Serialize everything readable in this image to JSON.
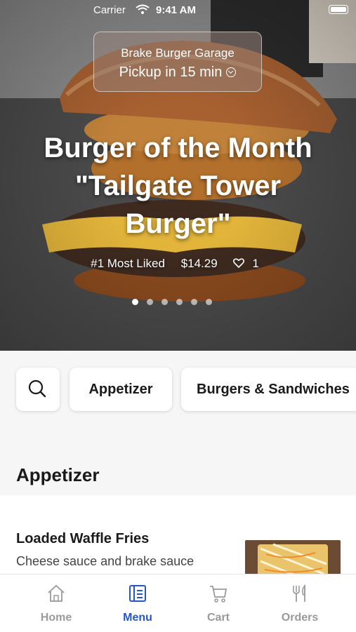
{
  "status_bar": {
    "carrier": "Carrier",
    "time": "9:41 AM"
  },
  "store": {
    "name": "Brake Burger Garage",
    "pickup": "Pickup in 15 min"
  },
  "promo": {
    "headline_line1": "Burger of the Month",
    "headline_line2": "\"Tailgate Tower",
    "headline_line3": "Burger\"",
    "badge": "#1 Most Liked",
    "price": "$14.29",
    "likes": "1",
    "carousel_pages": 6,
    "carousel_active": 1
  },
  "categories": {
    "search_icon": "search-icon",
    "items": [
      "Appetizer",
      "Burgers & Sandwiches"
    ]
  },
  "section": {
    "title": "Appetizer"
  },
  "menu_item": {
    "title": "Loaded Waffle Fries",
    "description": "Cheese sauce and brake sauce"
  },
  "tabs": [
    {
      "label": "Home",
      "icon": "home-icon",
      "active": false
    },
    {
      "label": "Menu",
      "icon": "menu-icon",
      "active": true
    },
    {
      "label": "Cart",
      "icon": "cart-icon",
      "active": false
    },
    {
      "label": "Orders",
      "icon": "orders-icon",
      "active": false
    }
  ],
  "colors": {
    "accent": "#2457c5",
    "inactive_tab": "#9a9a9a"
  }
}
